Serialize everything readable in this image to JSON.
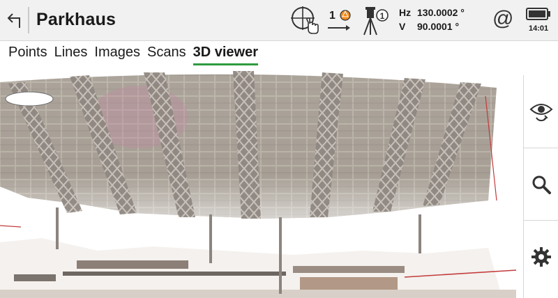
{
  "header": {
    "title": "Parkhaus",
    "prism_count": "1",
    "hz_label": "Hz",
    "hz_value": "130.0002 °",
    "v_label": "V",
    "v_value": "90.0001 °",
    "at_symbol": "@",
    "time": "14:01",
    "icons": [
      "back-arrow-icon",
      "target-touch-icon",
      "prism-icon",
      "tripod-instrument-icon",
      "at-icon",
      "battery-icon"
    ]
  },
  "tabs": [
    {
      "label": "Points",
      "active": false
    },
    {
      "label": "Lines",
      "active": false
    },
    {
      "label": "Images",
      "active": false
    },
    {
      "label": "Scans",
      "active": false
    },
    {
      "label": "3D viewer",
      "active": true
    }
  ],
  "toolbar": {
    "icons": [
      "eye-rotate-icon",
      "search-icon",
      "gear-icon"
    ]
  },
  "colors": {
    "accent": "#2e9b3f",
    "header_bg": "#f1f1f1",
    "prism_orange": "#f08a1c"
  }
}
